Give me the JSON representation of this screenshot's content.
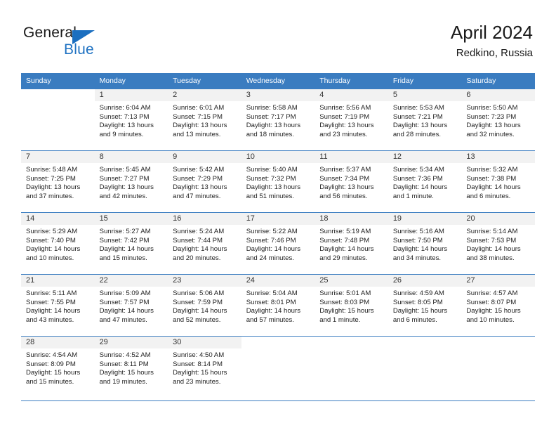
{
  "brand": {
    "word_general": "General",
    "word_blue": "Blue",
    "logo_icon": "triangle-logo-icon"
  },
  "header": {
    "title": "April 2024",
    "subtitle": "Redkino, Russia"
  },
  "colors": {
    "header_blue": "#3a7cc0",
    "brand_blue": "#1f72c2",
    "daynum_bg": "#f2f2f2",
    "text": "#222222"
  },
  "weekday_headers": [
    "Sunday",
    "Monday",
    "Tuesday",
    "Wednesday",
    "Thursday",
    "Friday",
    "Saturday"
  ],
  "weeks": [
    [
      {
        "day": "",
        "lines": [],
        "blank": true
      },
      {
        "day": "1",
        "lines": [
          "Sunrise: 6:04 AM",
          "Sunset: 7:13 PM",
          "Daylight: 13 hours",
          "and 9 minutes."
        ]
      },
      {
        "day": "2",
        "lines": [
          "Sunrise: 6:01 AM",
          "Sunset: 7:15 PM",
          "Daylight: 13 hours",
          "and 13 minutes."
        ]
      },
      {
        "day": "3",
        "lines": [
          "Sunrise: 5:58 AM",
          "Sunset: 7:17 PM",
          "Daylight: 13 hours",
          "and 18 minutes."
        ]
      },
      {
        "day": "4",
        "lines": [
          "Sunrise: 5:56 AM",
          "Sunset: 7:19 PM",
          "Daylight: 13 hours",
          "and 23 minutes."
        ]
      },
      {
        "day": "5",
        "lines": [
          "Sunrise: 5:53 AM",
          "Sunset: 7:21 PM",
          "Daylight: 13 hours",
          "and 28 minutes."
        ]
      },
      {
        "day": "6",
        "lines": [
          "Sunrise: 5:50 AM",
          "Sunset: 7:23 PM",
          "Daylight: 13 hours",
          "and 32 minutes."
        ]
      }
    ],
    [
      {
        "day": "7",
        "lines": [
          "Sunrise: 5:48 AM",
          "Sunset: 7:25 PM",
          "Daylight: 13 hours",
          "and 37 minutes."
        ]
      },
      {
        "day": "8",
        "lines": [
          "Sunrise: 5:45 AM",
          "Sunset: 7:27 PM",
          "Daylight: 13 hours",
          "and 42 minutes."
        ]
      },
      {
        "day": "9",
        "lines": [
          "Sunrise: 5:42 AM",
          "Sunset: 7:29 PM",
          "Daylight: 13 hours",
          "and 47 minutes."
        ]
      },
      {
        "day": "10",
        "lines": [
          "Sunrise: 5:40 AM",
          "Sunset: 7:32 PM",
          "Daylight: 13 hours",
          "and 51 minutes."
        ]
      },
      {
        "day": "11",
        "lines": [
          "Sunrise: 5:37 AM",
          "Sunset: 7:34 PM",
          "Daylight: 13 hours",
          "and 56 minutes."
        ]
      },
      {
        "day": "12",
        "lines": [
          "Sunrise: 5:34 AM",
          "Sunset: 7:36 PM",
          "Daylight: 14 hours",
          "and 1 minute."
        ]
      },
      {
        "day": "13",
        "lines": [
          "Sunrise: 5:32 AM",
          "Sunset: 7:38 PM",
          "Daylight: 14 hours",
          "and 6 minutes."
        ]
      }
    ],
    [
      {
        "day": "14",
        "lines": [
          "Sunrise: 5:29 AM",
          "Sunset: 7:40 PM",
          "Daylight: 14 hours",
          "and 10 minutes."
        ]
      },
      {
        "day": "15",
        "lines": [
          "Sunrise: 5:27 AM",
          "Sunset: 7:42 PM",
          "Daylight: 14 hours",
          "and 15 minutes."
        ]
      },
      {
        "day": "16",
        "lines": [
          "Sunrise: 5:24 AM",
          "Sunset: 7:44 PM",
          "Daylight: 14 hours",
          "and 20 minutes."
        ]
      },
      {
        "day": "17",
        "lines": [
          "Sunrise: 5:22 AM",
          "Sunset: 7:46 PM",
          "Daylight: 14 hours",
          "and 24 minutes."
        ]
      },
      {
        "day": "18",
        "lines": [
          "Sunrise: 5:19 AM",
          "Sunset: 7:48 PM",
          "Daylight: 14 hours",
          "and 29 minutes."
        ]
      },
      {
        "day": "19",
        "lines": [
          "Sunrise: 5:16 AM",
          "Sunset: 7:50 PM",
          "Daylight: 14 hours",
          "and 34 minutes."
        ]
      },
      {
        "day": "20",
        "lines": [
          "Sunrise: 5:14 AM",
          "Sunset: 7:53 PM",
          "Daylight: 14 hours",
          "and 38 minutes."
        ]
      }
    ],
    [
      {
        "day": "21",
        "lines": [
          "Sunrise: 5:11 AM",
          "Sunset: 7:55 PM",
          "Daylight: 14 hours",
          "and 43 minutes."
        ]
      },
      {
        "day": "22",
        "lines": [
          "Sunrise: 5:09 AM",
          "Sunset: 7:57 PM",
          "Daylight: 14 hours",
          "and 47 minutes."
        ]
      },
      {
        "day": "23",
        "lines": [
          "Sunrise: 5:06 AM",
          "Sunset: 7:59 PM",
          "Daylight: 14 hours",
          "and 52 minutes."
        ]
      },
      {
        "day": "24",
        "lines": [
          "Sunrise: 5:04 AM",
          "Sunset: 8:01 PM",
          "Daylight: 14 hours",
          "and 57 minutes."
        ]
      },
      {
        "day": "25",
        "lines": [
          "Sunrise: 5:01 AM",
          "Sunset: 8:03 PM",
          "Daylight: 15 hours",
          "and 1 minute."
        ]
      },
      {
        "day": "26",
        "lines": [
          "Sunrise: 4:59 AM",
          "Sunset: 8:05 PM",
          "Daylight: 15 hours",
          "and 6 minutes."
        ]
      },
      {
        "day": "27",
        "lines": [
          "Sunrise: 4:57 AM",
          "Sunset: 8:07 PM",
          "Daylight: 15 hours",
          "and 10 minutes."
        ]
      }
    ],
    [
      {
        "day": "28",
        "lines": [
          "Sunrise: 4:54 AM",
          "Sunset: 8:09 PM",
          "Daylight: 15 hours",
          "and 15 minutes."
        ]
      },
      {
        "day": "29",
        "lines": [
          "Sunrise: 4:52 AM",
          "Sunset: 8:11 PM",
          "Daylight: 15 hours",
          "and 19 minutes."
        ]
      },
      {
        "day": "30",
        "lines": [
          "Sunrise: 4:50 AM",
          "Sunset: 8:14 PM",
          "Daylight: 15 hours",
          "and 23 minutes."
        ]
      },
      {
        "day": "",
        "lines": [],
        "blank": true
      },
      {
        "day": "",
        "lines": [],
        "blank": true
      },
      {
        "day": "",
        "lines": [],
        "blank": true
      },
      {
        "day": "",
        "lines": [],
        "blank": true
      }
    ]
  ]
}
